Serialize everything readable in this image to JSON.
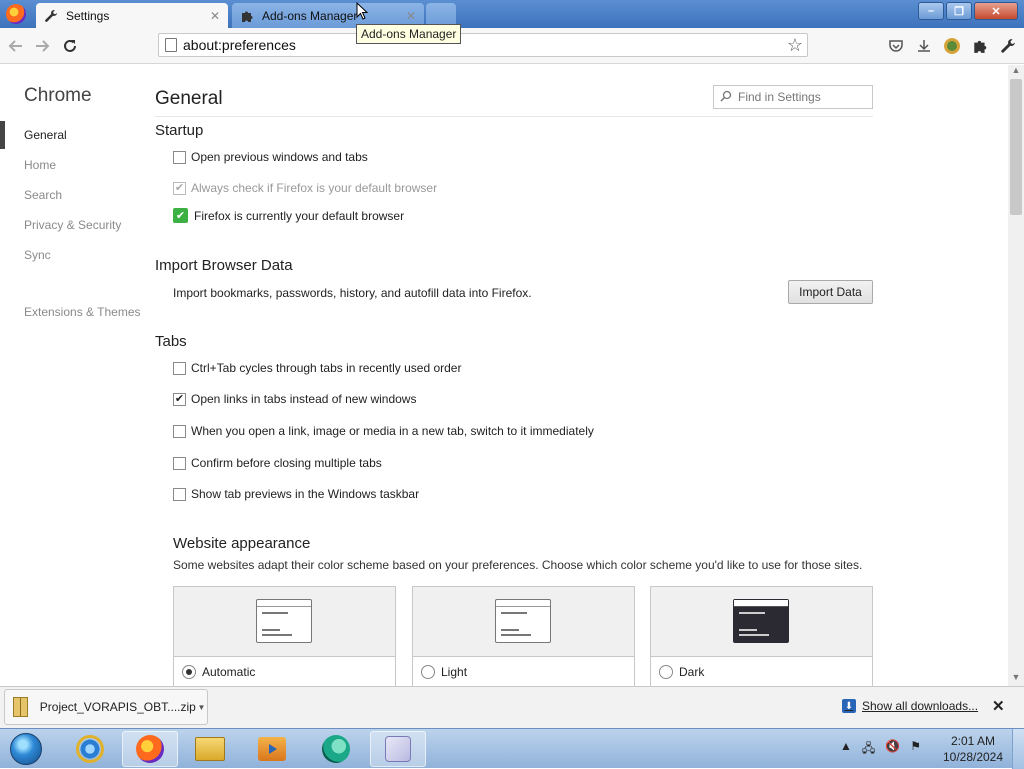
{
  "browser": {
    "tabs": [
      {
        "label": "Settings",
        "icon": "wrench-icon"
      },
      {
        "label": "Add-ons Manager",
        "icon": "puzzle-icon"
      }
    ],
    "tooltip": "Add-ons Manager",
    "url": "about:preferences"
  },
  "sidebar": {
    "brand": "Chrome",
    "items": [
      {
        "label": "General",
        "active": true
      },
      {
        "label": "Home"
      },
      {
        "label": "Search"
      },
      {
        "label": "Privacy & Security"
      },
      {
        "label": "Sync"
      },
      {
        "label": "Extensions & Themes"
      }
    ]
  },
  "general": {
    "title": "General",
    "find_placeholder": "Find in Settings",
    "startup": {
      "title": "Startup",
      "open_previous": "Open previous windows and tabs",
      "always_check": "Always check if Firefox is your default browser",
      "is_default": "Firefox is currently your default browser"
    },
    "import": {
      "title": "Import Browser Data",
      "desc": "Import bookmarks, passwords, history, and autofill data into Firefox.",
      "button": "Import Data"
    },
    "tabs": {
      "title": "Tabs",
      "ctrl_tab": "Ctrl+Tab cycles through tabs in recently used order",
      "open_links": "Open links in tabs instead of new windows",
      "switch_to": "When you open a link, image or media in a new tab, switch to it immediately",
      "confirm_close": "Confirm before closing multiple tabs",
      "previews": "Show tab previews in the Windows taskbar"
    },
    "appearance": {
      "title": "Website appearance",
      "desc": "Some websites adapt their color scheme based on your preferences. Choose which color scheme you'd like to use for those sites.",
      "options": [
        "Automatic",
        "Light",
        "Dark"
      ],
      "selected": "Automatic"
    }
  },
  "downloads": {
    "file": "Project_VORAPIS_OBT....zip",
    "show_all": "Show all downloads..."
  },
  "taskbar": {
    "time": "2:01 AM",
    "date": "10/28/2024"
  },
  "colors": {
    "titlebar": "#3d73bd",
    "checkbox_green": "#3cb043",
    "taskbar": "#90b2da"
  }
}
